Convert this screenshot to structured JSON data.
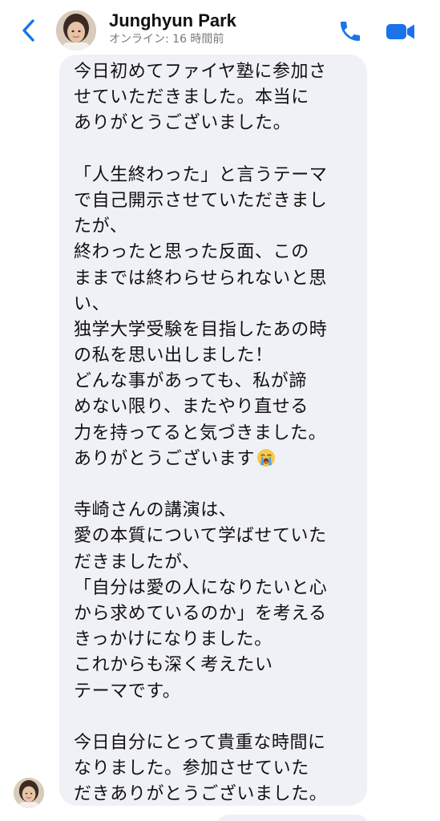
{
  "header": {
    "contact_name": "Junghyun Park",
    "status": "オンライン: 16 時間前",
    "back_icon": "chevron-left-icon",
    "call_icon": "phone-icon",
    "video_icon": "video-camera-icon",
    "accent_color": "#1a73e8"
  },
  "message": {
    "background_color": "#f0f1f6",
    "lines": [
      "今日初めてファイヤ塾に参加さ",
      "せていただきました。本当に",
      "ありがとうございました。",
      "",
      "「人生終わった」と言うテーマ",
      "で自己開示させていただきまし",
      "たが、",
      "終わったと思った反面、この",
      "ままでは終わらせられないと思",
      "い、",
      "独学大学受験を目指したあの時",
      "の私を思い出しました！",
      "どんな事があっても、私が諦",
      "めない限り、またやり直せる",
      "力を持ってると気づきました。",
      "ありがとうございます",
      "",
      "寺崎さんの講演は、",
      "愛の本質について学ばせていた",
      "だきましたが、",
      "「自分は愛の人になりたいと心",
      "から求めているのか」を考える",
      "きっかけになりました。",
      "これからも深く考えたい",
      "テーマです。",
      "",
      "今日自分にとって貴重な時間に",
      "なりました。参加させていた",
      "だきありがとうございました。"
    ],
    "emoji_icon": "crying-face-icon"
  }
}
